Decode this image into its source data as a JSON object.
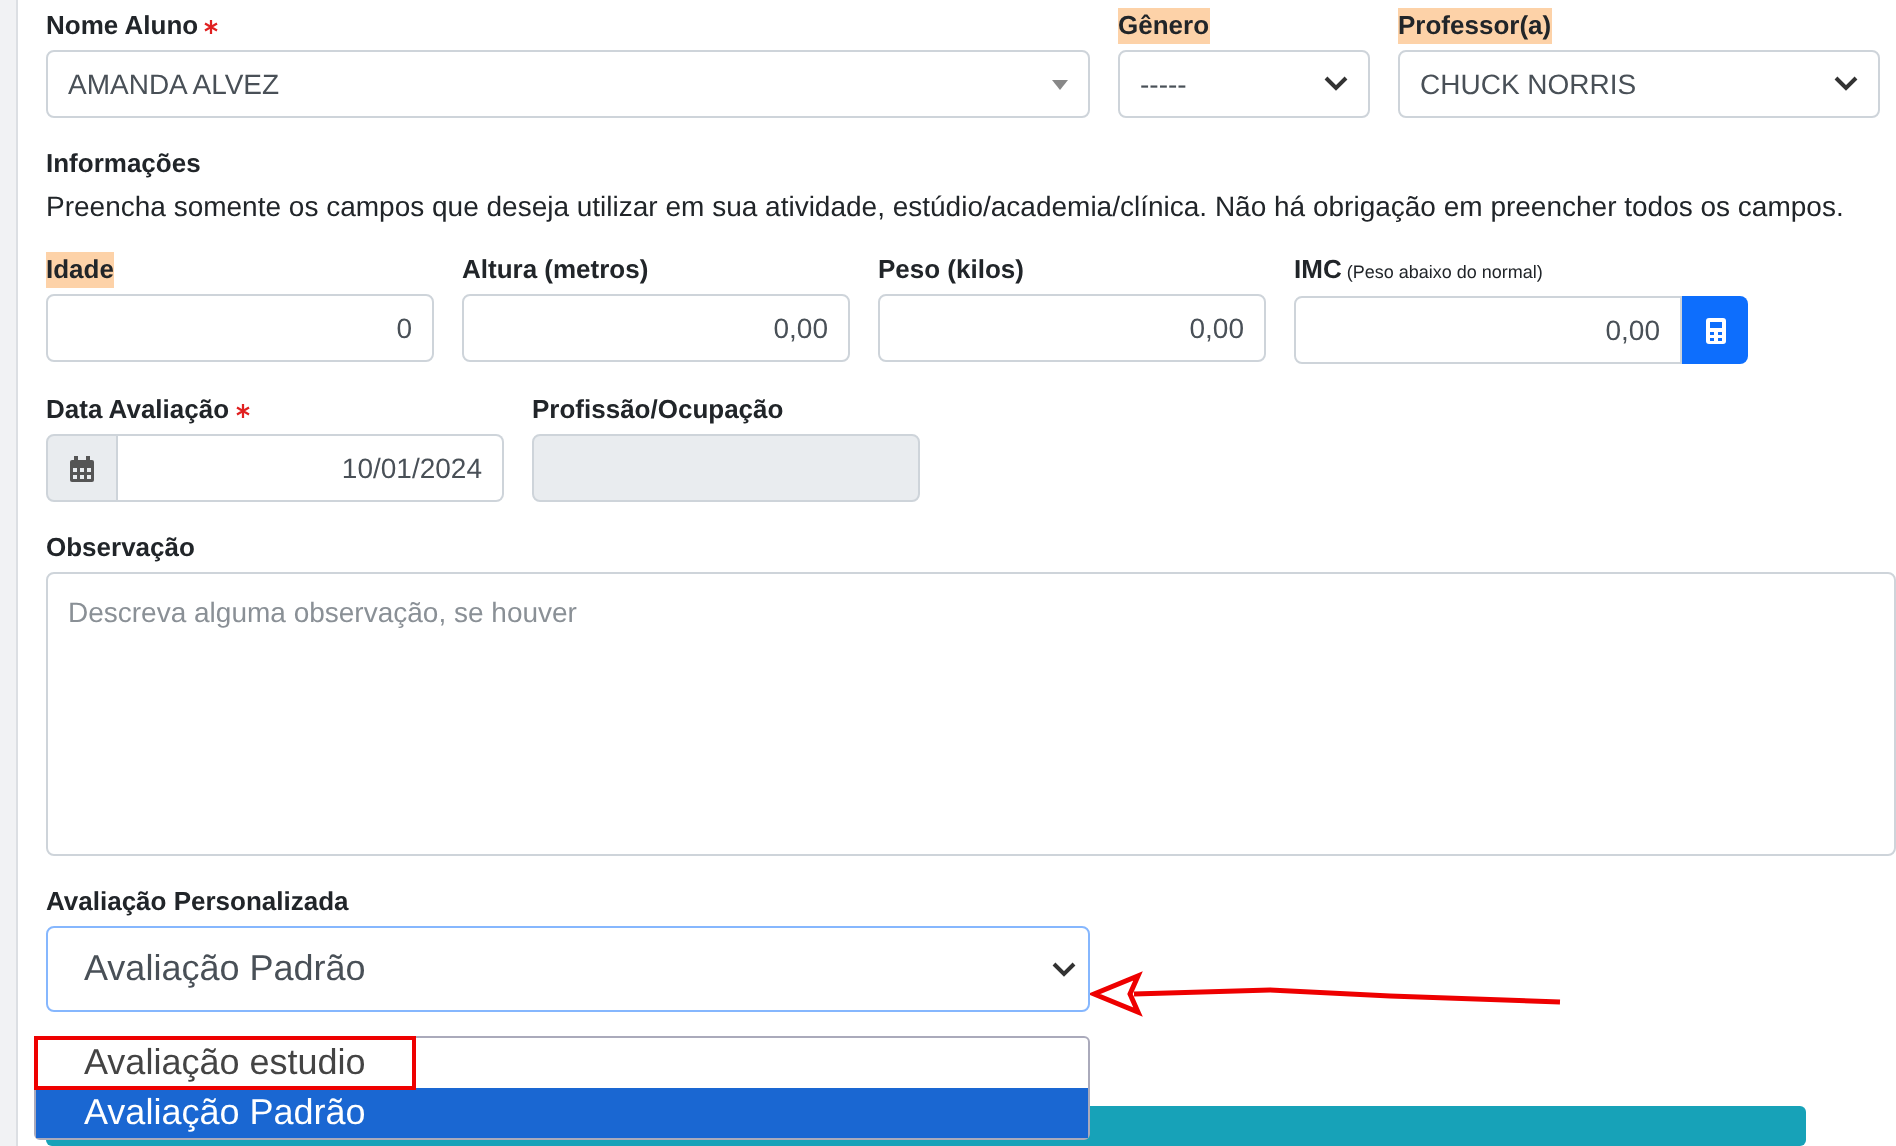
{
  "rows": [
    {
      "fields": [
        {
          "kind": "combo",
          "label": "Nome Aluno",
          "required": true,
          "highlighted": false,
          "value": "AMANDA ALVEZ"
        },
        {
          "kind": "select",
          "label": "Gênero",
          "required": false,
          "highlighted": true,
          "value": "-----"
        },
        {
          "kind": "select",
          "label": "Professor(a)",
          "required": false,
          "highlighted": true,
          "value": "CHUCK NORRIS"
        }
      ]
    },
    {
      "fields": [
        {
          "kind": "info",
          "label": "Informações",
          "text": "Preencha somente os campos que deseja utilizar em sua atividade, estúdio/academia/clínica. Não há obrigação em preencher todos os campos."
        }
      ]
    },
    {
      "fields": [
        {
          "kind": "number",
          "label": "Idade",
          "required": false,
          "highlighted": true,
          "value": "0"
        },
        {
          "kind": "number",
          "label": "Altura (metros)",
          "required": false,
          "highlighted": false,
          "value": "0,00"
        },
        {
          "kind": "number",
          "label": "Peso (kilos)",
          "required": false,
          "highlighted": false,
          "value": "0,00"
        },
        {
          "kind": "calc",
          "label": "IMC",
          "note": "(Peso abaixo do normal)",
          "required": false,
          "highlighted": false,
          "value": "0,00"
        }
      ]
    },
    {
      "fields": [
        {
          "kind": "date",
          "label": "Data Avaliação",
          "required": true,
          "highlighted": false,
          "value": "10/01/2024"
        },
        {
          "kind": "disabled",
          "label": "Profissão/Ocupação",
          "required": false,
          "highlighted": false
        }
      ]
    },
    {
      "fields": [
        {
          "kind": "textarea",
          "label": "Observação",
          "required": false,
          "highlighted": false,
          "placeholder": "Descreva alguma observação, se houver"
        }
      ]
    },
    {
      "fields": [
        {
          "kind": "dropdown",
          "label": "Avaliação Personalizada",
          "required": false,
          "highlighted": false,
          "value": "Avaliação Padrão",
          "options": [
            {
              "label": "Avaliação estudio",
              "selected": false,
              "boxed": true
            },
            {
              "label": "Avaliação Padrão",
              "selected": true,
              "boxed": false
            }
          ]
        }
      ]
    }
  ]
}
